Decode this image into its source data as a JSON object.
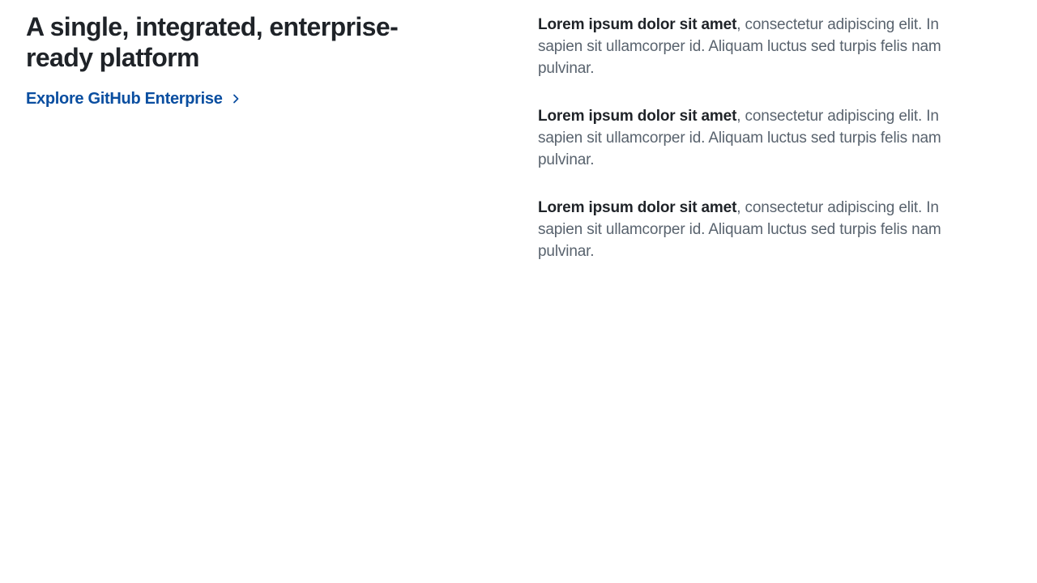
{
  "section": {
    "headline_lines": [
      "A single, integrated, enterprise-",
      "ready platform"
    ],
    "explore_link": {
      "label": "Explore GitHub Enterprise",
      "icon": "chevron-right-icon",
      "color": "#0a4ea0"
    },
    "features": [
      {
        "title": "Lorem ipsum dolor sit amet",
        "line1_rest": ", consectetur adipiscing elit. In",
        "line2": "sapien sit ullamcorper id. Aliquam luctus sed turpis felis nam",
        "line3": "pulvinar."
      },
      {
        "title": "Lorem ipsum dolor sit amet",
        "line1_rest": ", consectetur adipiscing elit. In",
        "line2": "sapien sit ullamcorper id. Aliquam luctus sed turpis felis nam",
        "line3": "pulvinar."
      },
      {
        "title": "Lorem ipsum dolor sit amet",
        "line1_rest": ", consectetur adipiscing elit. In",
        "line2": "sapien sit ullamcorper id. Aliquam luctus sed turpis felis nam",
        "line3": "pulvinar."
      }
    ]
  },
  "colors": {
    "heading": "#1f2328",
    "body_text": "#59636e",
    "link": "#0a4ea0",
    "background": "#ffffff"
  }
}
